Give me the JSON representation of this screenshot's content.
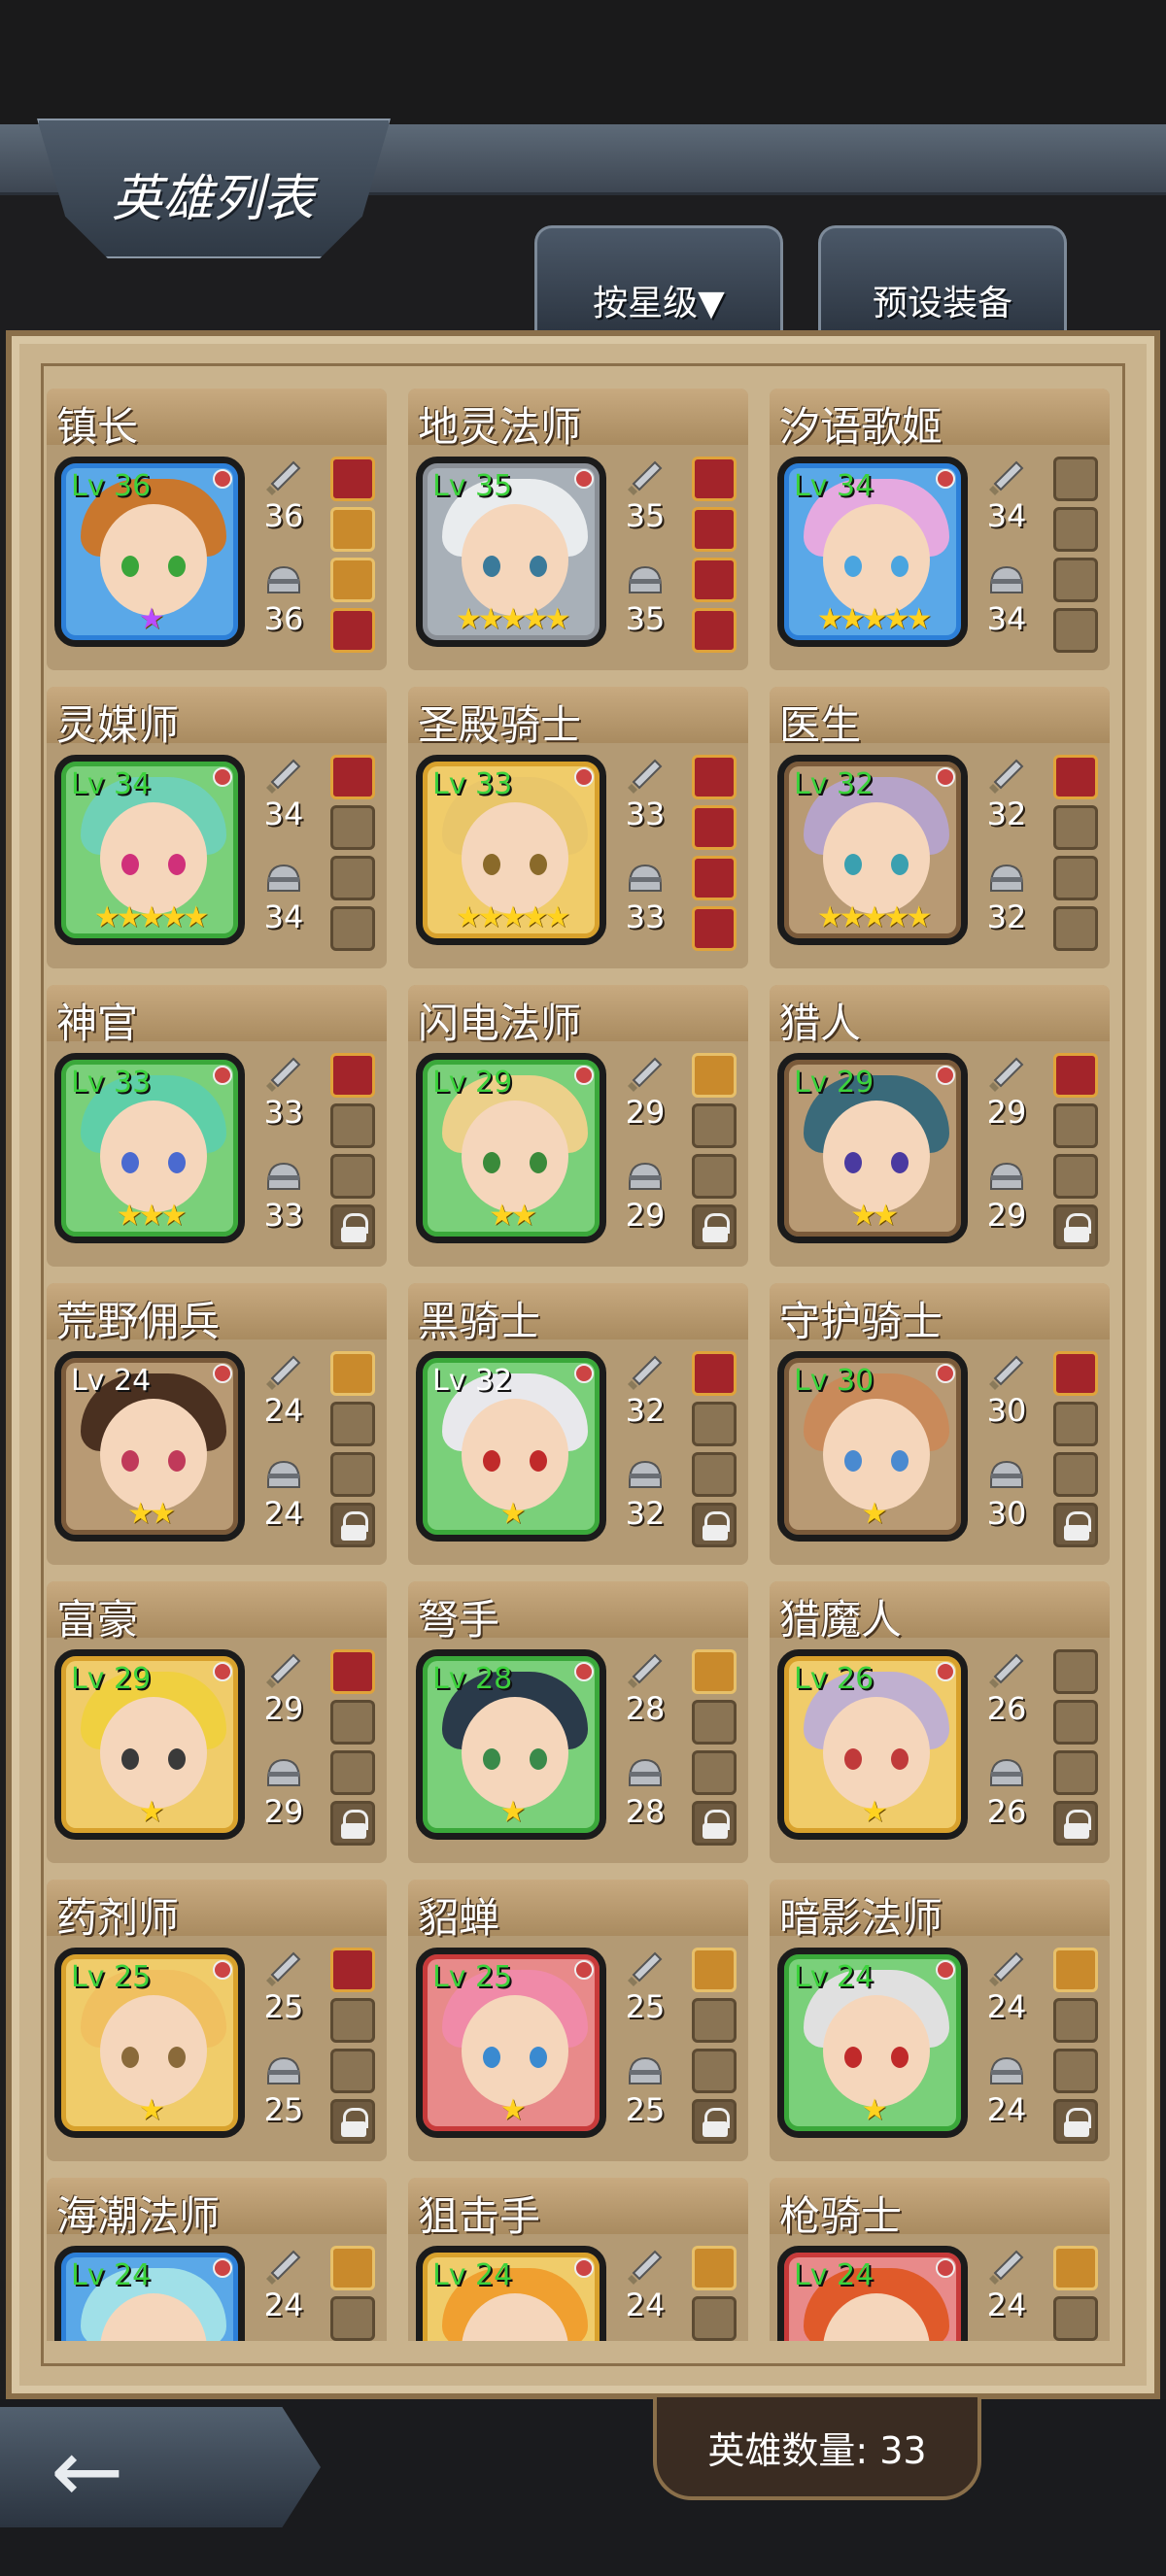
{
  "header": {
    "title": "英雄列表"
  },
  "tabs": [
    {
      "label": "按星级▼"
    },
    {
      "label": "预设装备"
    }
  ],
  "footer": {
    "hero_count": "英雄数量: 33"
  },
  "heroes": [
    {
      "name": "镇长",
      "level": "Lv 36",
      "attack": "36",
      "defense": "36",
      "stars": "★",
      "star_color": "purple",
      "frame": "blue",
      "hair": "#c9772d",
      "eyes": "#3aa53a",
      "slots": [
        "filled",
        "gold",
        "gold",
        "filled"
      ]
    },
    {
      "name": "地灵法师",
      "level": "Lv 35",
      "attack": "35",
      "defense": "35",
      "stars": "★★★★★",
      "frame": "gray",
      "hair": "#e9ecee",
      "eyes": "#3a7a9a",
      "slots": [
        "filled",
        "filled",
        "filled",
        "filled"
      ]
    },
    {
      "name": "汐语歌姬",
      "level": "Lv 34",
      "attack": "34",
      "defense": "34",
      "stars": "★★★★★",
      "frame": "blue",
      "hair": "#e5a9e0",
      "eyes": "#4aa5e0",
      "slots": [
        "empty",
        "empty",
        "empty",
        "empty"
      ]
    },
    {
      "name": "灵媒师",
      "level": "Lv 34",
      "attack": "34",
      "defense": "34",
      "stars": "★★★★★",
      "frame": "green",
      "hair": "#6fd1b6",
      "eyes": "#d0307a",
      "slots": [
        "filled",
        "empty",
        "empty",
        "empty"
      ]
    },
    {
      "name": "圣殿骑士",
      "level": "Lv 33",
      "attack": "33",
      "defense": "33",
      "stars": "★★★★★",
      "frame": "gold",
      "hair": "#e9c66a",
      "eyes": "#8a6a2a",
      "slots": [
        "filled",
        "filled",
        "filled",
        "filled"
      ]
    },
    {
      "name": "医生",
      "level": "Lv 32",
      "attack": "32",
      "defense": "32",
      "stars": "★★★★★",
      "frame": "brown",
      "hair": "#b6a3c9",
      "eyes": "#3aa0b0",
      "slots": [
        "filled",
        "empty",
        "empty",
        "empty"
      ]
    },
    {
      "name": "神官",
      "level": "Lv 33",
      "attack": "33",
      "defense": "33",
      "stars": "★★★",
      "frame": "green",
      "hair": "#5fcfa8",
      "eyes": "#4a6ad0",
      "slots": [
        "filled",
        "empty",
        "empty",
        "lock"
      ]
    },
    {
      "name": "闪电法师",
      "level": "Lv 29",
      "attack": "29",
      "defense": "29",
      "stars": "★★",
      "frame": "green",
      "hair": "#ecd08a",
      "eyes": "#3a8a3a",
      "slots": [
        "gold",
        "empty",
        "empty",
        "lock"
      ]
    },
    {
      "name": "猎人",
      "level": "Lv 29",
      "attack": "29",
      "defense": "29",
      "stars": "★★",
      "frame": "brown",
      "hair": "#3a6a7a",
      "eyes": "#4a3aa0",
      "slots": [
        "filled",
        "empty",
        "empty",
        "lock"
      ]
    },
    {
      "name": "荒野佣兵",
      "level": "Lv 24",
      "attack": "24",
      "defense": "24",
      "stars": "★★",
      "frame": "brown",
      "hair": "#4a3020",
      "eyes": "#c03a5a",
      "slots": [
        "gold",
        "empty",
        "empty",
        "lock"
      ],
      "lv_white": true
    },
    {
      "name": "黑骑士",
      "level": "Lv 32",
      "attack": "32",
      "defense": "32",
      "stars": "★",
      "frame": "green",
      "hair": "#e8e8ec",
      "eyes": "#c02a2a",
      "slots": [
        "filled",
        "empty",
        "empty",
        "lock"
      ],
      "lv_white": true
    },
    {
      "name": "守护骑士",
      "level": "Lv 30",
      "attack": "30",
      "defense": "30",
      "stars": "★",
      "frame": "brown",
      "hair": "#c98a5a",
      "eyes": "#4a8ad0",
      "slots": [
        "filled",
        "empty",
        "empty",
        "lock"
      ]
    },
    {
      "name": "富豪",
      "level": "Lv 29",
      "attack": "29",
      "defense": "29",
      "stars": "★",
      "frame": "gold",
      "hair": "#f0d040",
      "eyes": "#3a3a3a",
      "slots": [
        "filled",
        "empty",
        "empty",
        "lock"
      ]
    },
    {
      "name": "弩手",
      "level": "Lv 28",
      "attack": "28",
      "defense": "28",
      "stars": "★",
      "frame": "green",
      "hair": "#2a3a4a",
      "eyes": "#3a8a4a",
      "slots": [
        "gold",
        "empty",
        "empty",
        "lock"
      ]
    },
    {
      "name": "猎魔人",
      "level": "Lv 26",
      "attack": "26",
      "defense": "26",
      "stars": "★",
      "frame": "gold",
      "hair": "#c0b0d0",
      "eyes": "#c03a3a",
      "slots": [
        "empty",
        "empty",
        "empty",
        "lock"
      ]
    },
    {
      "name": "药剂师",
      "level": "Lv 25",
      "attack": "25",
      "defense": "25",
      "stars": "★",
      "frame": "gold",
      "hair": "#f0c060",
      "eyes": "#8a6a3a",
      "slots": [
        "filled",
        "empty",
        "empty",
        "lock"
      ]
    },
    {
      "name": "貂蝉",
      "level": "Lv 25",
      "attack": "25",
      "defense": "25",
      "stars": "★",
      "frame": "red",
      "hair": "#f08aa8",
      "eyes": "#3a8ad0",
      "slots": [
        "gold",
        "empty",
        "empty",
        "lock"
      ]
    },
    {
      "name": "暗影法师",
      "level": "Lv 24",
      "attack": "24",
      "defense": "24",
      "stars": "★",
      "frame": "green",
      "hair": "#e0e0e0",
      "eyes": "#c02a2a",
      "slots": [
        "gold",
        "empty",
        "empty",
        "lock"
      ]
    },
    {
      "name": "海潮法师",
      "level": "Lv 24",
      "attack": "24",
      "defense": "",
      "stars": "",
      "frame": "blue",
      "hair": "#a0e0e8",
      "eyes": "#3aa0d0",
      "slots": [
        "gold",
        "empty",
        "empty",
        "lock"
      ]
    },
    {
      "name": "狙击手",
      "level": "Lv 24",
      "attack": "24",
      "defense": "",
      "stars": "",
      "frame": "gold",
      "hair": "#f0a030",
      "eyes": "#3a3a3a",
      "slots": [
        "gold",
        "empty",
        "empty",
        "lock"
      ]
    },
    {
      "name": "枪骑士",
      "level": "Lv 24",
      "attack": "24",
      "defense": "",
      "stars": "",
      "frame": "red",
      "hair": "#e05a2a",
      "eyes": "#3a3a3a",
      "slots": [
        "gold",
        "empty",
        "empty",
        "lock"
      ]
    }
  ],
  "colors": {
    "panel": "#c9b38d",
    "level_text": "#3cd23c",
    "star": "#ffd21f"
  }
}
